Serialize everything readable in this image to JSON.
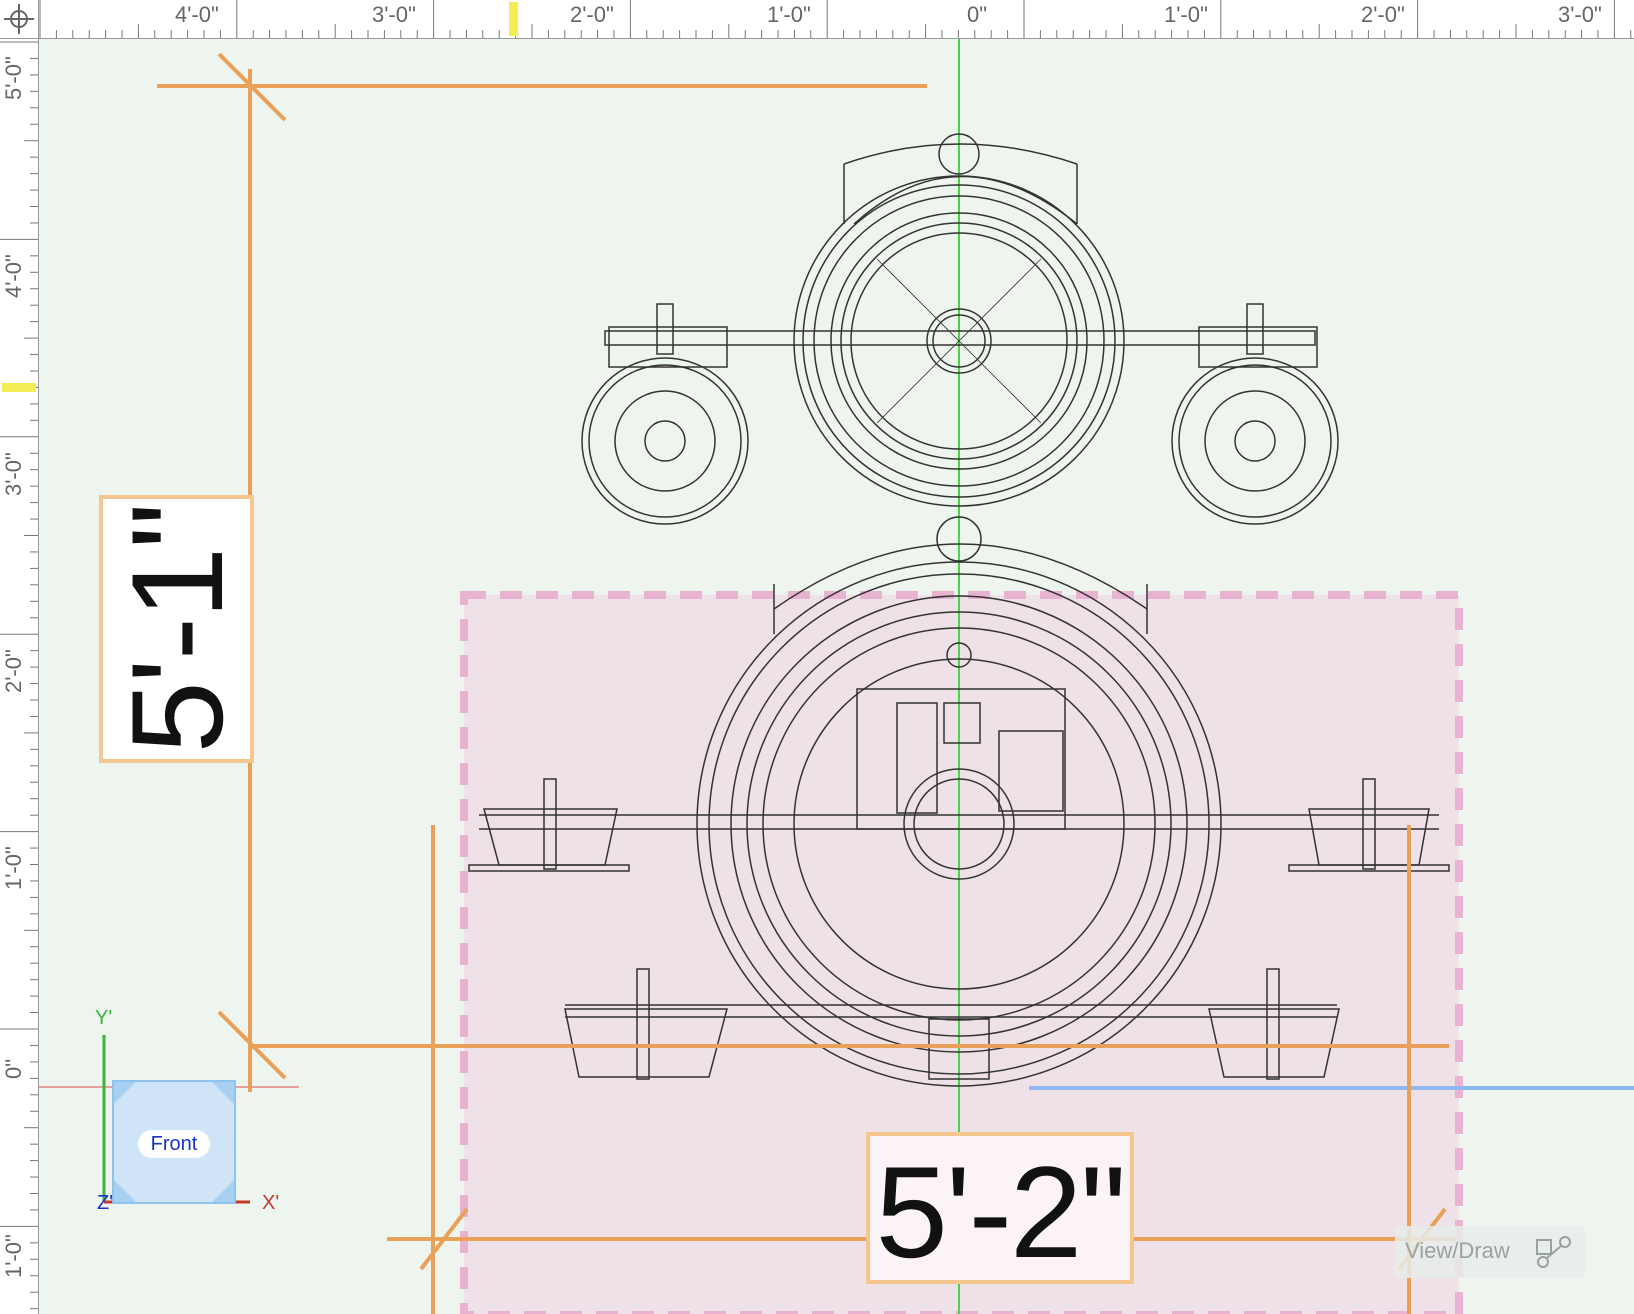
{
  "rulers": {
    "horizontal_labels": [
      "4'-0\"",
      "3'-0\"",
      "2'-0\"",
      "1'-0\"",
      "0\"",
      "1'-0\"",
      "2'-0\"",
      "3'-0\""
    ],
    "vertical_labels": [
      "5'-0\"",
      "4'-0\"",
      "3'-0\"",
      "2'-0\"",
      "1'-0\"",
      "0\"",
      "1'-0\""
    ]
  },
  "dimensions": {
    "width_label": "5'-2\"",
    "height_label": "5'-1\""
  },
  "view_cube": {
    "face_label": "Front",
    "x_axis": "X'",
    "y_axis": "Y'",
    "z_axis": "Z'"
  },
  "mode_button": {
    "label": "View/Draw",
    "icon": "view-draw-icon"
  },
  "colors": {
    "background": "#eef5ee",
    "dimension_line": "#e9a15a",
    "dimension_box_border": "#f3c78f",
    "selection_fill": "#eddde6",
    "selection_dash": "#e7b3d1",
    "green_axis": "#4cd34c",
    "red_axis": "#e04a4a",
    "blue_axis": "#8fb8f0",
    "drawing_lines": "#333333"
  }
}
